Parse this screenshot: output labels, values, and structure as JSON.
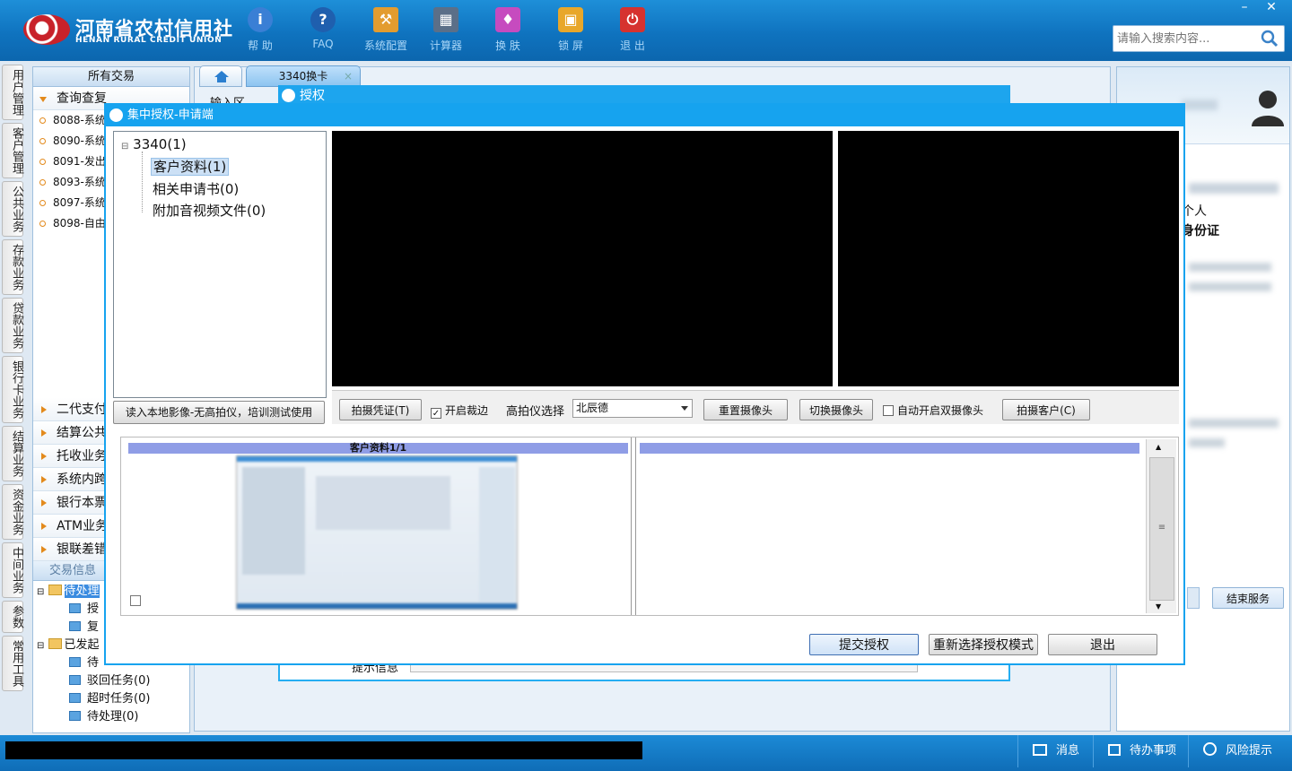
{
  "app": {
    "logo_cn": "河南省农村信用社",
    "logo_en": "HENAN RURAL CREDIT UNION",
    "toolbar": [
      {
        "label": "帮 助",
        "icon": "info-icon",
        "glyph": "i",
        "color": "#3a7fd5"
      },
      {
        "label": "FAQ",
        "icon": "question-icon",
        "glyph": "?",
        "color": "#1f5fae"
      },
      {
        "label": "系统配置",
        "icon": "toolbox-icon",
        "glyph": "⚒",
        "color": "#e39c2f"
      },
      {
        "label": "计算器",
        "icon": "calculator-icon",
        "glyph": "▦",
        "color": "#5b6f88"
      },
      {
        "label": "换 肤",
        "icon": "shirt-icon",
        "glyph": "♦",
        "color": "#c64bbf"
      },
      {
        "label": "锁 屏",
        "icon": "lock-icon",
        "glyph": "▣",
        "color": "#e8a72a"
      },
      {
        "label": "退 出",
        "icon": "power-icon",
        "glyph": "⏻",
        "color": "#d6322f"
      }
    ],
    "search_placeholder": "请输入搜索内容...",
    "window_controls": [
      "–",
      "✕"
    ]
  },
  "vertical_tabs": [
    "用户管理",
    "客户管理",
    "公共业务",
    "存款业务",
    "贷款业务",
    "银行卡业务",
    "结算业务",
    "资金业务",
    "中间业务",
    "参数",
    "常用工具"
  ],
  "left_panel": {
    "header": "所有交易",
    "open_group": "查询查复",
    "items": [
      "8088-系统",
      "8090-系统",
      "8091-发出",
      "8093-系统",
      "8097-系统",
      "8098-自由"
    ],
    "groups": [
      "二代支付",
      "结算公共",
      "托收业务",
      "系统内跨",
      "银行本票",
      "ATM业务",
      "银联差错"
    ],
    "info_header": "交易信息",
    "tree": [
      "待处理",
      "授",
      "复",
      "已发起",
      "待",
      "驳回任务(0)",
      "超时任务(0)",
      "待处理(0)"
    ]
  },
  "main": {
    "card_tab": "3340换卡",
    "card_tab_close": "×",
    "auth_title": "授权",
    "input_area": "输入区",
    "hint_label": "提示信息"
  },
  "right_panel": {
    "cust_type": "个人",
    "id_type": "身份证",
    "end_service": "结束服务"
  },
  "dialog": {
    "title": "集中授权-申请端",
    "tree": {
      "root": "3340(1)",
      "nodes": [
        "客户资料(1)",
        "相关申请书(0)",
        "附加音视频文件(0)"
      ]
    },
    "read_local": "读入本地影像-无高拍仪，培训测试使用",
    "controls": {
      "capture_voucher": "拍摄凭证(T)",
      "auto_crop": "开启裁边",
      "scanner_label": "高拍仪选择",
      "scanner_value": "北辰德",
      "reset_camera": "重置摄像头",
      "switch_camera": "切换摄像头",
      "dual_camera": "自动开启双摄像头",
      "capture_customer": "拍摄客户(C)"
    },
    "thumb_header": "客户资料1/1",
    "submit": "提交授权",
    "rechoose": "重新选择授权模式",
    "exit": "退出"
  },
  "status_bar": {
    "messages": "消息",
    "todo": "待办事项",
    "risk": "风险提示"
  }
}
